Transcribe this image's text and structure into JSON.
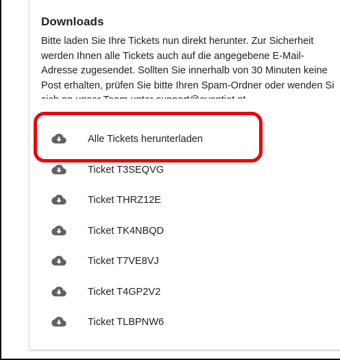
{
  "downloads": {
    "title": "Downloads",
    "description_lines": [
      "Bitte laden Sie Ihre Tickets nun direkt herunter. Zur Sicherheit",
      "werden Ihnen alle Tickets auch auf die angegebene E-Mail-",
      "Adresse zugesendet. Sollten Sie innerhalb von 30 Minuten keine",
      "Post erhalten, prüfen Sie bitte Ihren Spam-Ordner oder wenden Si",
      "sich an unser Team unter support@eventjet.at."
    ],
    "items": [
      {
        "label": "Alle Tickets herunterladen",
        "icon": "cloud-download-icon"
      },
      {
        "label": "Ticket T3SEQVG",
        "icon": "cloud-download-icon"
      },
      {
        "label": "Ticket THRZ12E",
        "icon": "cloud-download-icon"
      },
      {
        "label": "Ticket TK4NBQD",
        "icon": "cloud-download-icon"
      },
      {
        "label": "Ticket T7VE8VJ",
        "icon": "cloud-download-icon"
      },
      {
        "label": "Ticket T4GP2V2",
        "icon": "cloud-download-icon"
      },
      {
        "label": "Ticket TLBPNW6",
        "icon": "cloud-download-icon"
      }
    ]
  },
  "colors": {
    "highlight": "#e8070b",
    "icon": "#5f6368",
    "text": "#212121"
  }
}
